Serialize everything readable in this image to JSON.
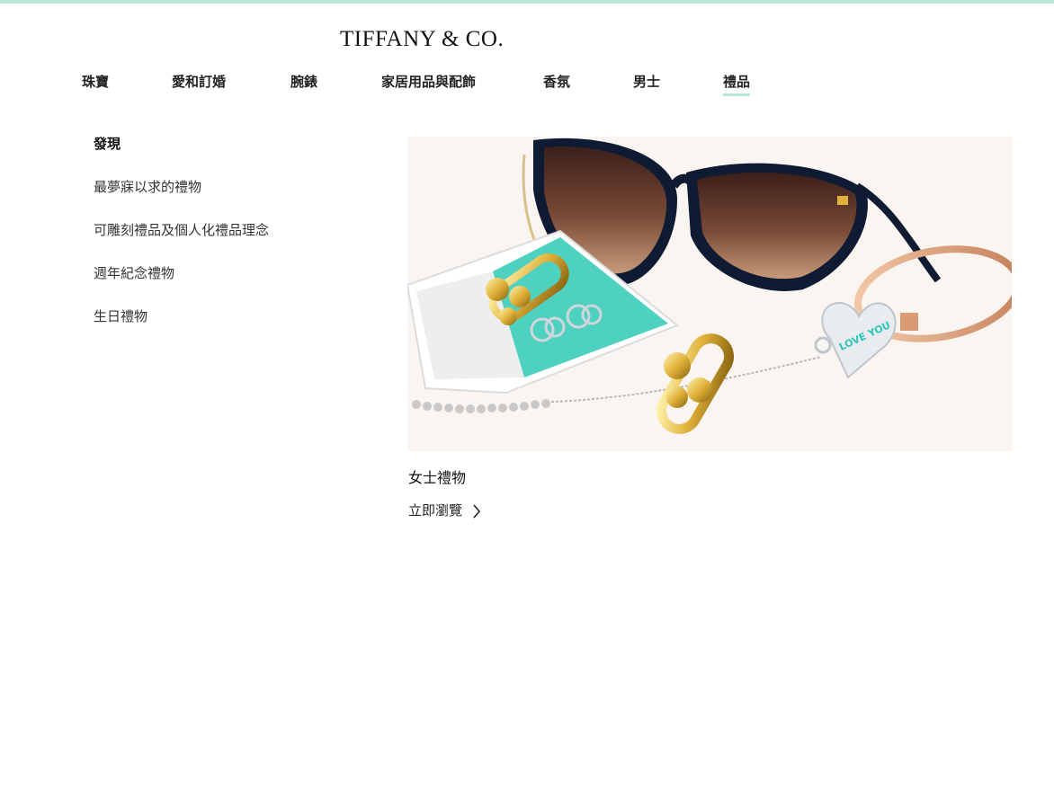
{
  "brand": {
    "logo_text": "TIFFANY & CO."
  },
  "nav": {
    "items": [
      {
        "label": "珠寶"
      },
      {
        "label": "愛和訂婚"
      },
      {
        "label": "腕錶"
      },
      {
        "label": "家居用品與配飾"
      },
      {
        "label": "香氛"
      },
      {
        "label": "男士"
      },
      {
        "label": "禮品",
        "active": true
      }
    ]
  },
  "sidebar": {
    "heading": "發現",
    "items": [
      {
        "label": "最夢寐以求的禮物"
      },
      {
        "label": "可雕刻禮品及個人化禮品理念"
      },
      {
        "label": "週年紀念禮物"
      },
      {
        "label": "生日禮物"
      }
    ]
  },
  "feature": {
    "title": "女士禮物",
    "link_label": "立即瀏覽",
    "engraving_text": "LOVE YOU"
  },
  "colors": {
    "accent": "#b9e7d9",
    "tiffany_blue": "#2ec4b6",
    "text": "#1a1a1a"
  }
}
